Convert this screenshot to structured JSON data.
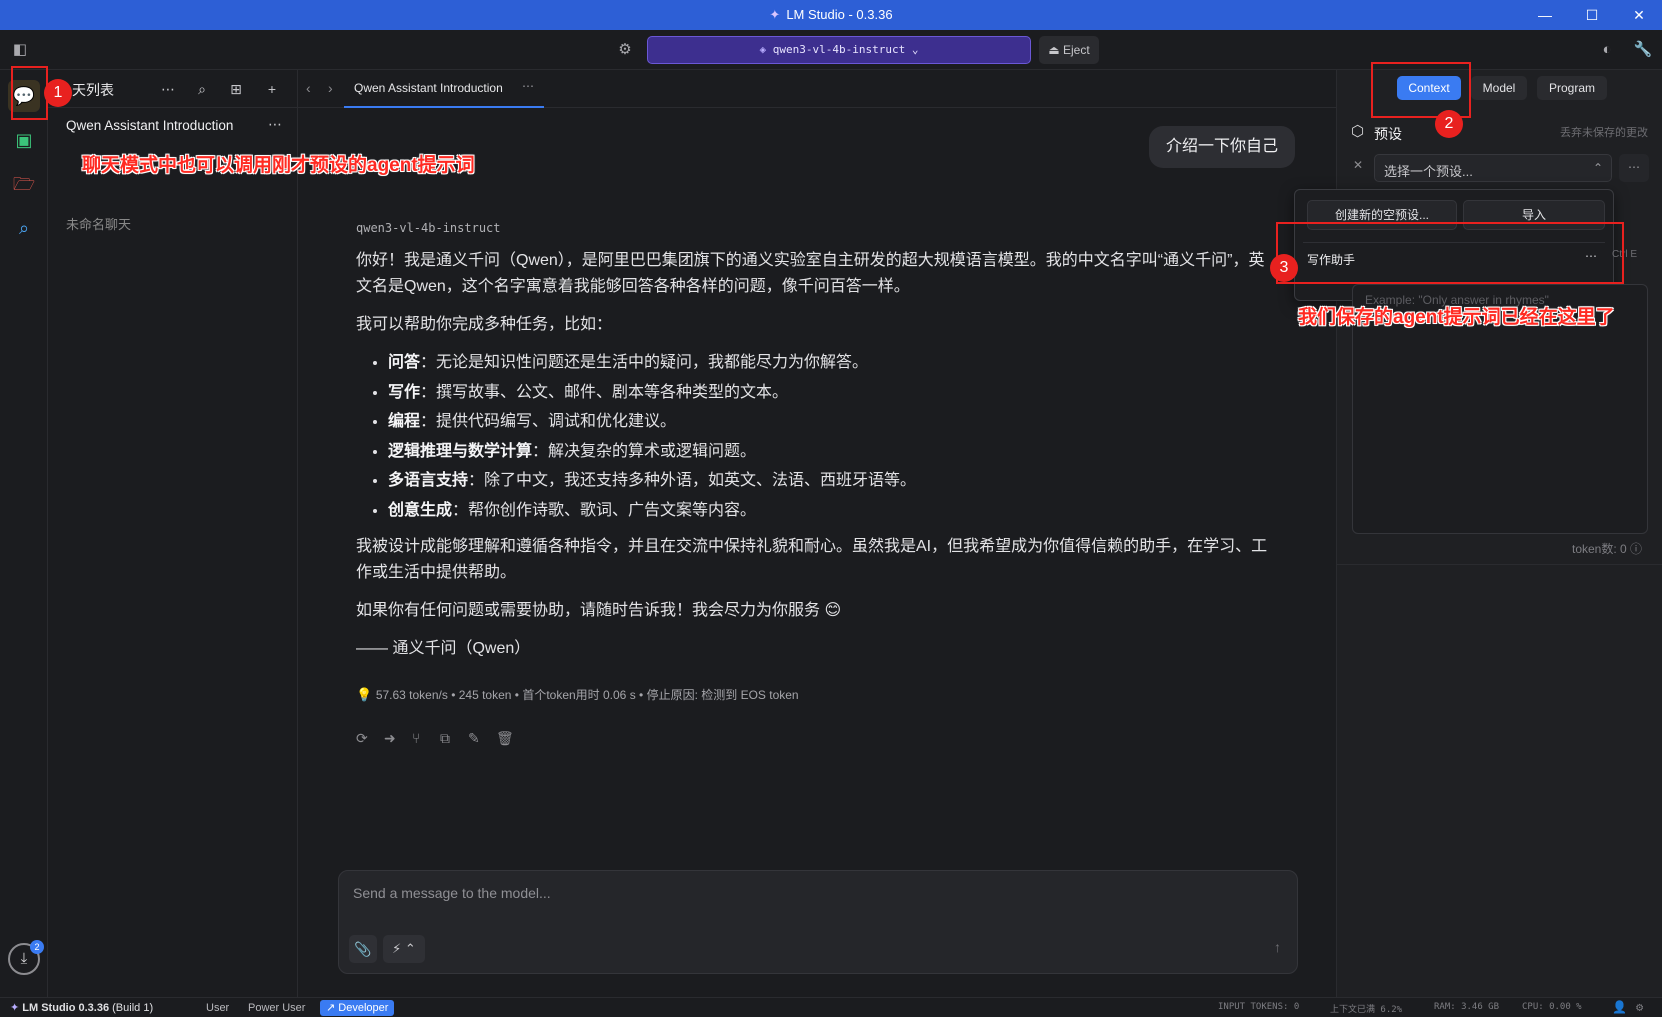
{
  "window": {
    "title": "LM Studio - 0.3.36",
    "minimize": "—",
    "maximize": "☐",
    "close": "✕"
  },
  "toolbar": {
    "model": "qwen3-vl-4b-instruct",
    "eject": "Eject"
  },
  "chat_list": {
    "header": "天列表",
    "items": [
      {
        "title": "Qwen Assistant Introduction"
      }
    ],
    "folder": "未命名聊天"
  },
  "tab": {
    "title": "Qwen Assistant Introduction"
  },
  "conversation": {
    "user_message": "介绍一下你自己",
    "model_name": "qwen3-vl-4b-instruct",
    "paragraph1": "你好！我是通义千问（Qwen），是阿里巴巴集团旗下的通义实验室自主研发的超大规模语言模型。我的中文名字叫“通义千问”，英文名是Qwen，这个名字寓意着我能够回答各种各样的问题，像千问百答一样。",
    "paragraph2": "我可以帮助你完成多种任务，比如：",
    "bullets": [
      {
        "bold": "问答",
        "text": "：无论是知识性问题还是生活中的疑问，我都能尽力为你解答。"
      },
      {
        "bold": "写作",
        "text": "：撰写故事、公文、邮件、剧本等各种类型的文本。"
      },
      {
        "bold": "编程",
        "text": "：提供代码编写、调试和优化建议。"
      },
      {
        "bold": "逻辑推理与数学计算",
        "text": "：解决复杂的算术或逻辑问题。"
      },
      {
        "bold": "多语言支持",
        "text": "：除了中文，我还支持多种外语，如英文、法语、西班牙语等。"
      },
      {
        "bold": "创意生成",
        "text": "：帮你创作诗歌、歌词、广告文案等内容。"
      }
    ],
    "paragraph3": "我被设计成能够理解和遵循各种指令，并且在交流中保持礼貌和耐心。虽然我是AI，但我希望成为你值得信赖的助手，在学习、工作或生活中提供帮助。",
    "paragraph4": "如果你有任何问题或需要协助，请随时告诉我！我会尽力为你服务 😊",
    "signature": "—— 通义千问（Qwen）",
    "stats": "57.63 token/s • 245 token • 首个token用时 0.06 s • 停止原因: 检测到 EOS token"
  },
  "composer": {
    "placeholder": "Send a message to the model..."
  },
  "right_panel": {
    "tabs": [
      "Context",
      "Model",
      "Program"
    ],
    "preset_label": "预设",
    "discard": "丢弃未保存的更改",
    "select_placeholder": "选择一个预设...",
    "create_new": "创建新的空预设...",
    "import": "导入",
    "preset_item": "写作助手",
    "shortcut": "Ctrl E",
    "system_prompt_placeholder": "Example: \"Only answer in rhymes\"",
    "token_count": "token数: 0"
  },
  "status_bar": {
    "app": "LM Studio 0.3.36",
    "build": "(Build 1)",
    "modes": [
      "User",
      "Power User",
      "Developer"
    ],
    "input_tokens": "INPUT TOKENS: 0",
    "context": "上下文已满 6.2%",
    "ram": "RAM: 3.46 GB",
    "cpu": "CPU: 0.00 %"
  },
  "rail": {
    "download_badge": "2"
  },
  "annotations": {
    "num1": "1",
    "num2": "2",
    "num3": "3",
    "text1": "聊天模式中也可以调用刚才预设的agent提示词",
    "text2": "我们保存的agent提示词已经在这里了"
  },
  "colors": {
    "titlebar": "#2d5fd6",
    "model_selector": "#3d2f8f",
    "context_tab": "#3a7bf2",
    "developer_badge": "#3a7bf2",
    "annotation_red": "#e8211f"
  }
}
